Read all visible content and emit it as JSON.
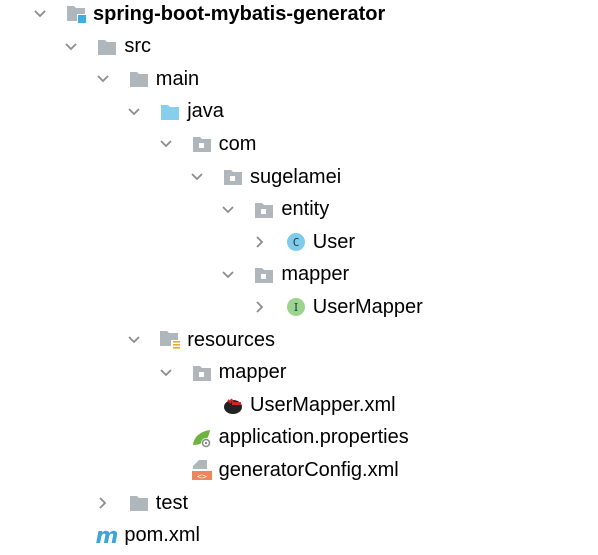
{
  "project_tree": {
    "items": [
      {
        "label": "spring-boot-mybatis-generator",
        "depth": 0,
        "state": "expanded",
        "icon": "module-folder-icon",
        "bold": true
      },
      {
        "label": "src",
        "depth": 1,
        "state": "expanded",
        "icon": "folder-icon"
      },
      {
        "label": "main",
        "depth": 2,
        "state": "expanded",
        "icon": "folder-icon"
      },
      {
        "label": "java",
        "depth": 3,
        "state": "expanded",
        "icon": "source-root-folder-icon"
      },
      {
        "label": "com",
        "depth": 4,
        "state": "expanded",
        "icon": "package-icon"
      },
      {
        "label": "sugelamei",
        "depth": 5,
        "state": "expanded",
        "icon": "package-icon"
      },
      {
        "label": "entity",
        "depth": 6,
        "state": "expanded",
        "icon": "package-icon"
      },
      {
        "label": "User",
        "depth": 7,
        "state": "collapsed",
        "icon": "class-icon"
      },
      {
        "label": "mapper",
        "depth": 6,
        "state": "expanded",
        "icon": "package-icon"
      },
      {
        "label": "UserMapper",
        "depth": 7,
        "state": "collapsed",
        "icon": "interface-icon"
      },
      {
        "label": "resources",
        "depth": 3,
        "state": "expanded",
        "icon": "resources-folder-icon"
      },
      {
        "label": "mapper",
        "depth": 4,
        "state": "expanded",
        "icon": "package-icon"
      },
      {
        "label": "UserMapper.xml",
        "depth": 5,
        "state": "leaf",
        "icon": "mybatis-xml-icon"
      },
      {
        "label": "application.properties",
        "depth": 4,
        "state": "leaf",
        "icon": "spring-properties-icon"
      },
      {
        "label": "generatorConfig.xml",
        "depth": 4,
        "state": "leaf",
        "icon": "xml-file-icon"
      },
      {
        "label": "test",
        "depth": 2,
        "state": "collapsed",
        "icon": "folder-icon"
      },
      {
        "label": "pom.xml",
        "depth": 1,
        "state": "leaf",
        "icon": "maven-pom-icon"
      }
    ]
  },
  "colors": {
    "folder": "#AFB6BC",
    "source_root": "#87CEEB",
    "accent": "#3DAEE0",
    "class": "#7FCBEA",
    "interface": "#9BD48E",
    "xml": "#F0845A",
    "spring": "#6DB33F",
    "chevron": "#8C8C8C",
    "maven": "#3DA6D8"
  }
}
